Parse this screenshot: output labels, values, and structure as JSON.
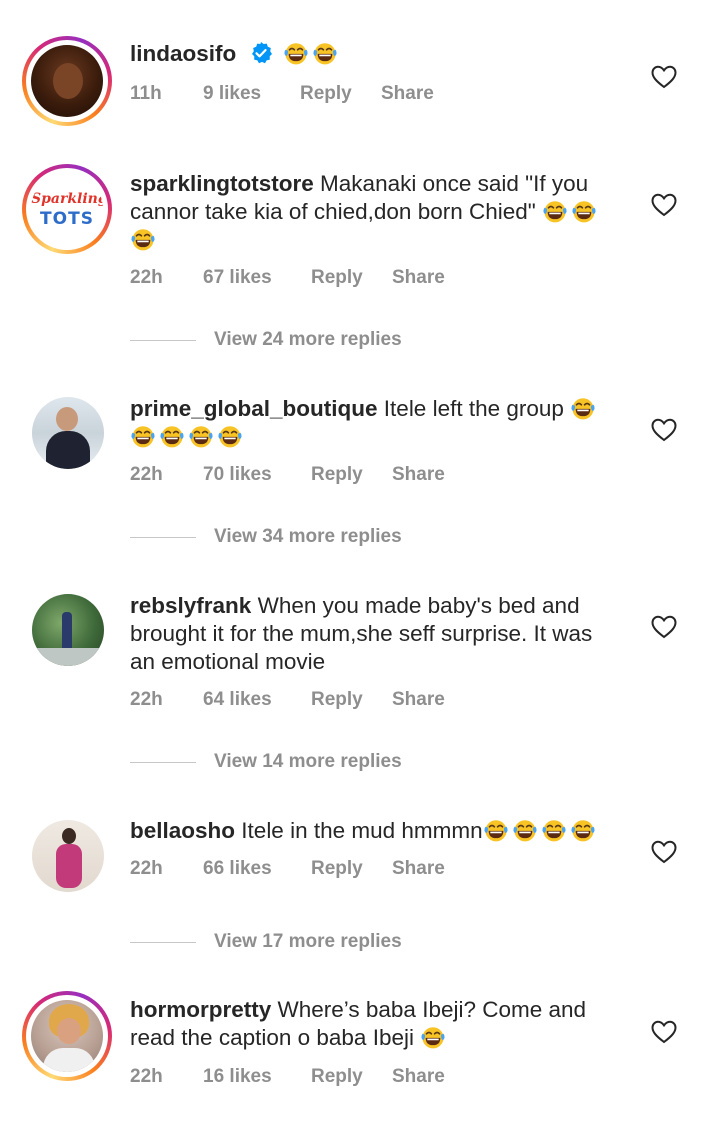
{
  "comments": [
    {
      "username": "lindaosifo",
      "verified": true,
      "text": "",
      "emojis": 2,
      "time": "11h",
      "likes": "9 likes",
      "reply": "Reply",
      "share": "Share"
    },
    {
      "username": "sparklingtotstore",
      "text": "Makanaki once said \"If you cannor take kia of chied,don born Chied\"",
      "time": "22h",
      "likes": "67 likes",
      "reply": "Reply",
      "share": "Share",
      "view_replies": "View 24 more replies",
      "avatar_logo": [
        "Sparkling",
        "TOTS"
      ]
    },
    {
      "username": "prime_global_boutique",
      "text": "Itele left the group",
      "time": "22h",
      "likes": "70 likes",
      "reply": "Reply",
      "share": "Share",
      "view_replies": "View 34 more replies"
    },
    {
      "username": "rebslyfrank",
      "text": "When you made baby's bed and brought it for the mum,she seff surprise. It was an emotional movie",
      "time": "22h",
      "likes": "64 likes",
      "reply": "Reply",
      "share": "Share",
      "view_replies": "View 14 more replies"
    },
    {
      "username": "bellaosho",
      "text": "Itele in the mud hmmmn",
      "time": "22h",
      "likes": "66 likes",
      "reply": "Reply",
      "share": "Share",
      "view_replies": "View 17 more replies"
    },
    {
      "username": "hormorpretty",
      "text": "Where’s baba Ibeji? Come and read the caption o baba Ibeji",
      "time": "22h",
      "likes": "16 likes",
      "reply": "Reply",
      "share": "Share"
    }
  ],
  "colors": {
    "text": "#262626",
    "meta": "#8e8e8e",
    "verified": "#0095f6",
    "emoji_face": "#f7c325"
  },
  "icons": [
    "verified-badge-icon",
    "laughing-tears-emoji-icon",
    "heart-outline-icon"
  ]
}
